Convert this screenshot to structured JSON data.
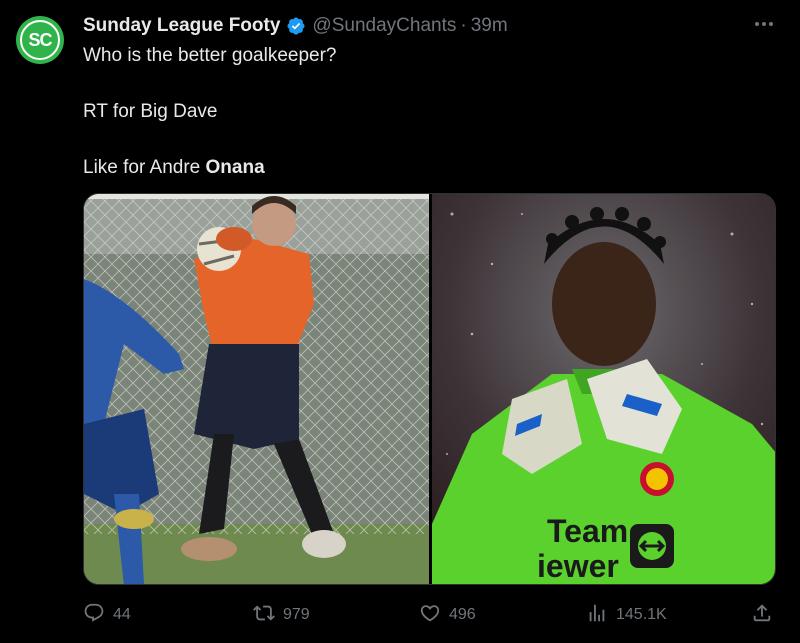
{
  "author": {
    "display_name": "Sunday League Footy",
    "handle": "@SundayChants",
    "separator": "·",
    "time": "39m",
    "avatar_text": "SC",
    "avatar_color": "#2fb34a",
    "verified_color": "#1d9bf0"
  },
  "tweet": {
    "line1": "Who is the better goalkeeper?",
    "line2": "RT for Big Dave",
    "line3_prefix": "Like for Andre ",
    "line3_bold": "Onana"
  },
  "media": {
    "left_photo": "amateur-goalkeeper-catching-ball",
    "right_photo": "andre-onana-green-kit",
    "right_shirt_text_1": "Team",
    "right_shirt_text_2": "iewer"
  },
  "actions": {
    "replies": "44",
    "retweets": "979",
    "likes": "496",
    "views": "145.1K"
  },
  "colors": {
    "background": "#000000",
    "text": "#e7e9ea",
    "muted": "#71767b",
    "link_blue": "#1d9bf0"
  }
}
